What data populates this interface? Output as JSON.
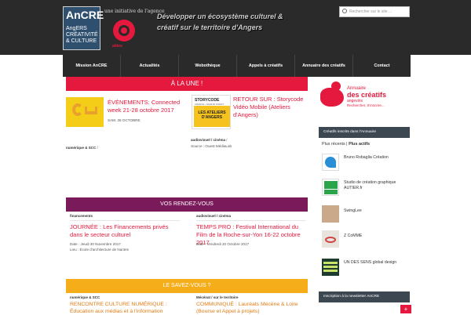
{
  "header": {
    "logo_title": "AnCRE",
    "logo_sub": "AngERS CRÉATIVITÉ & CULTURE",
    "tagline_small": "une initiative de l'agence",
    "aldev_label": "aldev",
    "tagline": "Développer un écosystème culturel & créatif sur le territoire d'Angers",
    "search_placeholder": "Rechercher sur le site ..."
  },
  "nav": {
    "items": [
      "Mission AnCRE",
      "Actualités",
      "Webothèque",
      "Appels à créatifs",
      "Annuaire des créatifs",
      "Contact"
    ]
  },
  "une": {
    "title": "À LA UNE !",
    "article1": {
      "title": "ÉVÈNEMENTS: Connected week 21-28 octobre 2017",
      "date": "SAM. 28 OCTOBRE",
      "category": "numérique & SCC",
      "category_sep": "/"
    },
    "article2": {
      "title": "RETOUR SUR : Storycode Vidéo Mobile (Ateliers d'Angers)",
      "category": "audiovisuel / cinéma",
      "category_sep": "/",
      "source": "Source : Ouest MédiaLab",
      "thumb_top": "STORYCODE",
      "thumb_sub": "FRANCE • GRAND OUEST",
      "thumb_block": "LES ATELIERS D'ANGERS"
    }
  },
  "rdv": {
    "title": "VOS RENDEZ-VOUS",
    "article1": {
      "category": "financements",
      "title": "JOURNÉE : Les Financements privés dans le secteur culturel",
      "date": "Date : Jeudi 30 Novembre 2017",
      "place": "Lieu : École d'architecture de Nantes"
    },
    "article2": {
      "category": "audiovisuel / cinéma",
      "title": "TEMPS PRO : Festival International du Film de la Roche-sur-Yon 16-22 octobre 2017",
      "date": "Date : Vendredi 20 Octobre 2017"
    }
  },
  "savez": {
    "title": "LE SAVEZ-VOUS ?",
    "article1": {
      "category": "numérique & SCC",
      "title": "RENCONTRE CULTURE NUMÉRIQUE : Éducation aux médias et à l'information"
    },
    "article2": {
      "category": "Mécénat / sur le territoire",
      "title": "COMMUNIQUÉ : Lauréats Mécène & Loire (Bourse et Appel à projets)"
    }
  },
  "sidebar": {
    "ad_line1": "Annuaire",
    "ad_line2": "des créatifs",
    "ad_line3": "angevins",
    "ad_line4": "Rechercher, S'inscrire...",
    "members_header": "Créatifs inscrits dans l'Annuaire",
    "tab_recent": "Plus récents",
    "tab_sep": "|",
    "tab_active": "Plus actifs",
    "members": [
      "Bruno Robaglia Création",
      "Studio de création graphique AUTIER.fr",
      "SwingLee",
      "Z CoMME",
      "UN DES SENS global design"
    ],
    "newsletter_header": "Inscription à la newsletter AnCRE",
    "newsletter_plus": "+"
  },
  "colors": {
    "red": "#e5183d",
    "purple": "#7b1a5b",
    "yellow": "#f6ad1a",
    "dark": "#2a2a2a"
  }
}
